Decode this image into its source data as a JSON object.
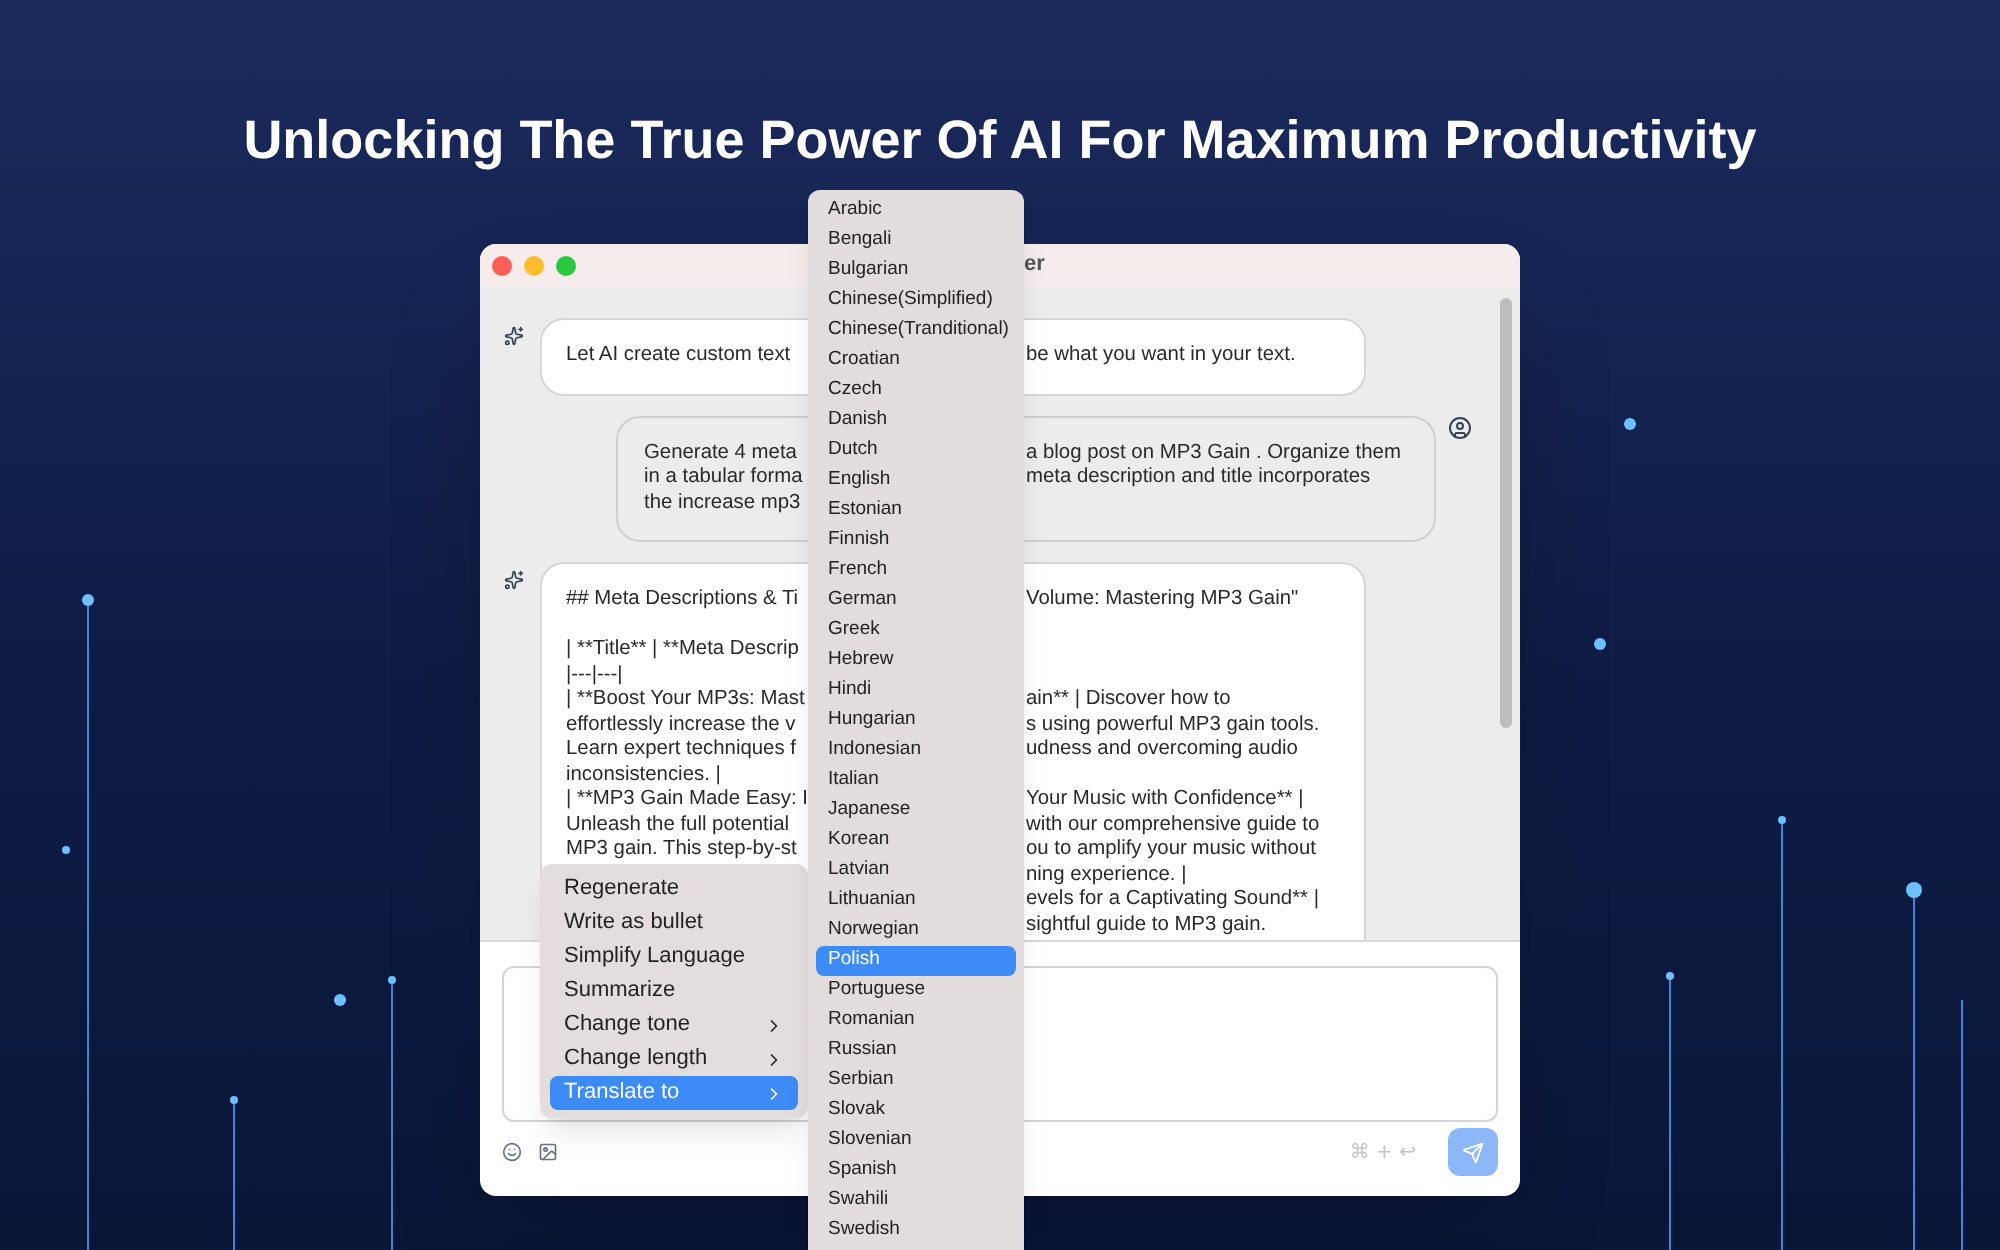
{
  "headline": "Unlocking The True Power Of AI For Maximum Productivity",
  "window": {
    "title": "er"
  },
  "messages": [
    {
      "kind": "assistant",
      "paragraphs": [
        [
          {
            "left": "Let AI create custom text",
            "right": "be what you want in your text."
          }
        ]
      ]
    },
    {
      "kind": "user",
      "paragraphs": [
        [
          {
            "left": "Generate 4 meta",
            "right": "a blog post on MP3 Gain . Organize them"
          },
          {
            "left": "in a tabular forma",
            "right": "meta description and title incorporates"
          },
          {
            "left": "the increase mp3"
          }
        ]
      ]
    },
    {
      "kind": "assistant",
      "paragraphs": [
        [
          {
            "left": "## Meta Descriptions & Ti",
            "right": "Volume: Mastering MP3 Gain\""
          }
        ],
        [
          {
            "left": "| **Title** | **Meta Descrip"
          },
          {
            "left": "|---|---|"
          },
          {
            "left": "| **Boost Your MP3s: Mast",
            "right": "ain** | Discover how to"
          },
          {
            "left": "effortlessly increase the v",
            "right": "s using powerful MP3 gain tools."
          },
          {
            "left": "Learn expert techniques f",
            "right": "udness and overcoming audio"
          },
          {
            "left": "inconsistencies. |"
          },
          {
            "left": "| **MP3 Gain Made Easy: I",
            "right": "Your Music with Confidence** |"
          },
          {
            "left": "Unleash the full potential",
            "right": "with our comprehensive guide to"
          },
          {
            "left": "MP3 gain. This step-by-st",
            "right": "ou to amplify your music without"
          },
          {
            "right": "ning experience. |"
          },
          {
            "right": "evels for a Captivating Sound** |"
          },
          {
            "right": "sightful guide to MP3 gain."
          }
        ]
      ]
    }
  ],
  "composer": {
    "shortcut_hint": "⌘ + ↩"
  },
  "context_menu": [
    {
      "label": "Regenerate",
      "has_submenu": false,
      "selected": false
    },
    {
      "label": "Write as bullet",
      "has_submenu": false,
      "selected": false
    },
    {
      "label": "Simplify Language",
      "has_submenu": false,
      "selected": false
    },
    {
      "label": "Summarize",
      "has_submenu": false,
      "selected": false
    },
    {
      "label": "Change tone",
      "has_submenu": true,
      "selected": false
    },
    {
      "label": "Change length",
      "has_submenu": true,
      "selected": false
    },
    {
      "label": "Translate to",
      "has_submenu": true,
      "selected": true
    }
  ],
  "language_menu": [
    {
      "label": "Arabic",
      "selected": false
    },
    {
      "label": "Bengali",
      "selected": false
    },
    {
      "label": "Bulgarian",
      "selected": false
    },
    {
      "label": "Chinese(Simplified)",
      "selected": false
    },
    {
      "label": "Chinese(Tranditional)",
      "selected": false
    },
    {
      "label": "Croatian",
      "selected": false
    },
    {
      "label": "Czech",
      "selected": false
    },
    {
      "label": "Danish",
      "selected": false
    },
    {
      "label": "Dutch",
      "selected": false
    },
    {
      "label": "English",
      "selected": false
    },
    {
      "label": "Estonian",
      "selected": false
    },
    {
      "label": "Finnish",
      "selected": false
    },
    {
      "label": "French",
      "selected": false
    },
    {
      "label": "German",
      "selected": false
    },
    {
      "label": "Greek",
      "selected": false
    },
    {
      "label": "Hebrew",
      "selected": false
    },
    {
      "label": "Hindi",
      "selected": false
    },
    {
      "label": "Hungarian",
      "selected": false
    },
    {
      "label": "Indonesian",
      "selected": false
    },
    {
      "label": "Italian",
      "selected": false
    },
    {
      "label": "Japanese",
      "selected": false
    },
    {
      "label": "Korean",
      "selected": false
    },
    {
      "label": "Latvian",
      "selected": false
    },
    {
      "label": "Lithuanian",
      "selected": false
    },
    {
      "label": "Norwegian",
      "selected": false
    },
    {
      "label": "Polish",
      "selected": true
    },
    {
      "label": "Portuguese",
      "selected": false
    },
    {
      "label": "Romanian",
      "selected": false
    },
    {
      "label": "Russian",
      "selected": false
    },
    {
      "label": "Serbian",
      "selected": false
    },
    {
      "label": "Slovak",
      "selected": false
    },
    {
      "label": "Slovenian",
      "selected": false
    },
    {
      "label": "Spanish",
      "selected": false
    },
    {
      "label": "Swahili",
      "selected": false
    },
    {
      "label": "Swedish",
      "selected": false
    }
  ]
}
